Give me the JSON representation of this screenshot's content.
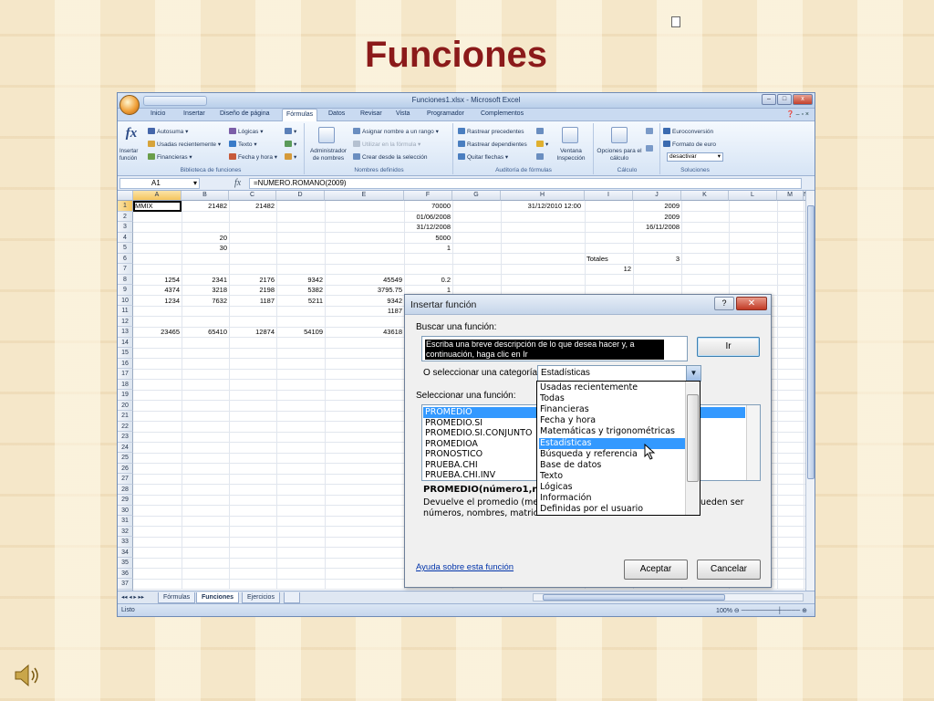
{
  "slide": {
    "title": "Funciones"
  },
  "excel": {
    "window_title": "Funciones1.xlsx - Microsoft Excel",
    "tabs": [
      "Inicio",
      "Insertar",
      "Diseño de página",
      "Fórmulas",
      "Datos",
      "Revisar",
      "Vista",
      "Programador",
      "Complementos"
    ],
    "active_tab": "Fórmulas",
    "ribbon": {
      "insert_function": "Insertar función",
      "autosuma": "Autosuma",
      "recientes": "Usadas recientemente",
      "financieras": "Financieras",
      "logicas": "Lógicas",
      "texto": "Texto",
      "fecha": "Fecha y hora",
      "lib_label": "Biblioteca de funciones",
      "admin": "Administrador de nombres",
      "asignar": "Asignar nombre a un rango",
      "utilizar": "Utilizar en la fórmula",
      "crear": "Crear desde la selección",
      "nombres_label": "Nombres definidos",
      "precedentes": "Rastrear precedentes",
      "dependientes": "Rastrear dependientes",
      "quitar": "Quitar flechas",
      "ventana": "Ventana Inspección",
      "auditoria_label": "Auditoría de fórmulas",
      "opciones": "Opciones para el cálculo",
      "calculo_label": "Cálculo",
      "euroconv": "Euroconversión",
      "formato_euro": "Formato de euro",
      "desactivar": "desactivar",
      "soluciones_label": "Soluciones"
    },
    "namebox": "A1",
    "formula": "=NUMERO.ROMANO(2009)",
    "columns": [
      "A",
      "B",
      "C",
      "D",
      "E",
      "F",
      "G",
      "H",
      "I",
      "J",
      "K",
      "L",
      "M",
      "N"
    ],
    "rows": [
      "1",
      "2",
      "3",
      "4",
      "5",
      "6",
      "7",
      "8",
      "9",
      "10",
      "11",
      "12",
      "13",
      "14",
      "15",
      "16",
      "17",
      "18",
      "19",
      "20",
      "21",
      "22",
      "23",
      "24",
      "25",
      "26",
      "27",
      "28",
      "29",
      "30",
      "31",
      "32",
      "33",
      "34",
      "35",
      "36",
      "37",
      "38"
    ],
    "cells": {
      "a1": "MMIX",
      "b1": "21482",
      "c1": "21482",
      "f1": "70000",
      "h1": "31/12/2010 12:00",
      "j1": "2009",
      "f2": "01/06/2008",
      "j2": "2009",
      "f3": "31/12/2008",
      "j3": "16/11/2008",
      "b4": "20",
      "f4": "5000",
      "b5": "30",
      "f5": "1",
      "i6": "Totales",
      "j6": "3",
      "i7": "12",
      "a8": "1254",
      "b8": "2341",
      "c8": "2176",
      "d8": "9342",
      "e8": "45549",
      "f8": "0.2",
      "a9": "4374",
      "b9": "3218",
      "c9": "2198",
      "d9": "5382",
      "e9": "3795.75",
      "f9": "1",
      "a10": "1234",
      "b10": "7632",
      "c10": "1187",
      "d10": "5211",
      "e10": "9342",
      "e11": "1187",
      "a13": "23465",
      "b13": "65410",
      "c13": "12874",
      "d13": "54109",
      "e13": "43618"
    },
    "sheets": [
      "Fórmulas",
      "Funciones",
      "Ejercicios"
    ],
    "active_sheet": "Funciones",
    "status": "Listo",
    "zoom": "100%"
  },
  "dialog": {
    "title": "Insertar función",
    "help": "?",
    "search_label": "Buscar una función:",
    "search_text": "Escriba una breve descripción de lo que desea hacer y, a continuación, haga clic en Ir",
    "go_button": "Ir",
    "category_label": "O seleccionar una categoría:",
    "category_value": "Estadísticas",
    "function_label": "Seleccionar una función:",
    "functions": [
      "PROMEDIO",
      "PROMEDIO.SI",
      "PROMEDIO.SI.CONJUNTO",
      "PROMEDIOA",
      "PRONOSTICO",
      "PRUEBA.CHI",
      "PRUEBA.CHI.INV"
    ],
    "selected_function": "PROMEDIO",
    "syntax": "PROMEDIO(número1,núm",
    "description_1": "Devuelve el promedio (medi",
    "description_1b": "s pueden ser",
    "description_2": "números, nombres, matrices",
    "help_link": "Ayuda sobre esta función",
    "ok": "Aceptar",
    "cancel": "Cancelar",
    "category_options": [
      "Usadas recientemente",
      "Todas",
      "Financieras",
      "Fecha y hora",
      "Matemáticas y trigonométricas",
      "Estadísticas",
      "Búsqueda y referencia",
      "Base de datos",
      "Texto",
      "Lógicas",
      "Información",
      "Definidas por el usuario"
    ],
    "highlighted_option": "Estadísticas"
  }
}
